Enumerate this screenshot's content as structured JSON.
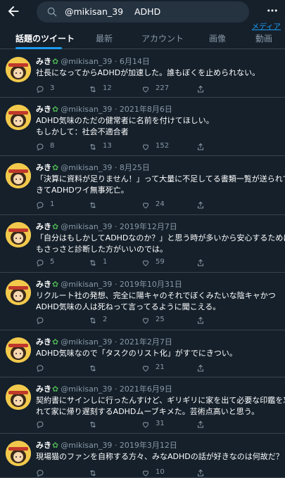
{
  "search": {
    "query": "@mikisan_39    ADHD"
  },
  "media_link": "メディア",
  "tabs": [
    {
      "label": "話題のツイート"
    },
    {
      "label": "最新"
    },
    {
      "label": "アカウント"
    },
    {
      "label": "画像"
    },
    {
      "label": "動画"
    }
  ],
  "tweets": [
    {
      "name": "みき",
      "handle": "@mikisan_39 · 6月14日",
      "text": "社長になってからADHDが加速した。誰もぼくを止められない。",
      "replies": "3",
      "retweets": "12",
      "likes": "227"
    },
    {
      "name": "みき",
      "handle": "@mikisan_39 · 2021年8月6日",
      "text": "ADHD気味のただの健常者に名前を付けてほしい。\nもしかして：社会不適合者",
      "replies": "8",
      "retweets": "13",
      "likes": "152"
    },
    {
      "name": "みき",
      "handle": "@mikisan_39 · 8月25日",
      "text": "「決算に資料が足りません！」って大量に不足してる書類一覧が送られて\nきてADHDワイ無事死亡。",
      "replies": "1",
      "retweets": "",
      "likes": "24"
    },
    {
      "name": "みき",
      "handle": "@mikisan_39 · 2019年12月7日",
      "text": "「自分はもしかしてADHDなのか？」と思う時が多いから安心するために\nもさっさと診断した方がいいのでは。",
      "replies": "5",
      "retweets": "1",
      "likes": "59"
    },
    {
      "name": "みき",
      "handle": "@mikisan_39 · 2019年10月31日",
      "text": "リクルート社の発想、完全に陽キャのそれでぼくみたいな陰キャかつ\nADHD気味の人は死ねって言ってるように聞こえる。",
      "replies": "",
      "retweets": "2",
      "likes": "25"
    },
    {
      "name": "みき",
      "handle": "@mikisan_39 · 2021年2月7日",
      "text": "ADHD気味なので「タスクのリスト化」がすでにきつい。",
      "replies": "",
      "retweets": "",
      "likes": "21"
    },
    {
      "name": "みき",
      "handle": "@mikisan_39 · 2021年6月9日",
      "text": "契約書にサインしに行ったんすけど、ギリギリに家を出て必要な印鑑を忘\nれて家に帰り遅刻するADHDムーブキメた。芸術点高いと思う。",
      "replies": "",
      "retweets": "",
      "likes": "31"
    },
    {
      "name": "みき",
      "handle": "@mikisan_39 · 2019年3月12日",
      "text": "現場猫のファンを自称する方々、みなADHDの話が好きなのは何故だ？",
      "replies": "",
      "retweets": "",
      "likes": "10"
    }
  ],
  "colors": {
    "background": "#15202b",
    "accent": "#1d9bf0",
    "muted": "#8899a6",
    "border": "#38444d"
  },
  "icons": [
    "back-arrow-icon",
    "search-icon",
    "more-icon",
    "reply-icon",
    "retweet-icon",
    "like-icon",
    "share-icon"
  ]
}
